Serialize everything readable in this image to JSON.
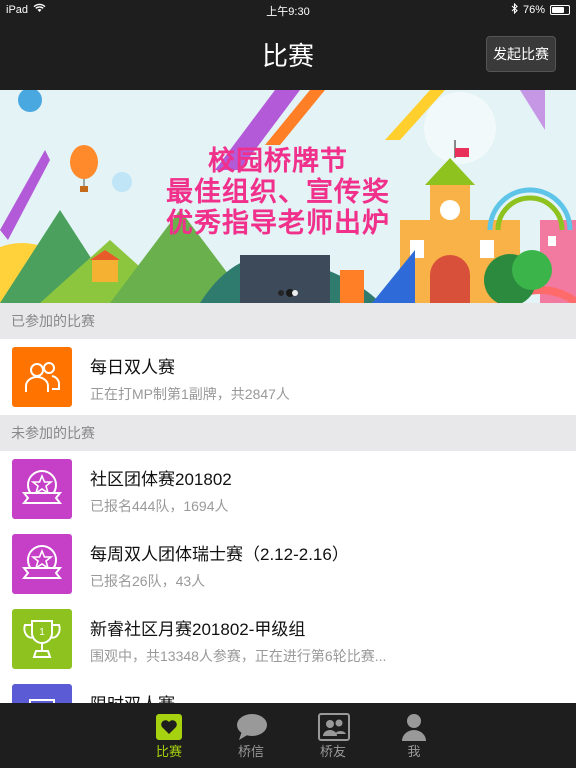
{
  "status": {
    "device": "iPad",
    "time": "上午9:30",
    "battery": "76%",
    "battery_level": 0.76
  },
  "nav": {
    "title": "比赛",
    "launch_button": "发起比赛"
  },
  "banner": {
    "lines": [
      "校园桥牌节",
      "最佳组织、宣传奖",
      "优秀指导老师出炉"
    ]
  },
  "sections": {
    "joined": "已参加的比赛",
    "not_joined": "未参加的比赛"
  },
  "joined_items": [
    {
      "name": "每日双人赛",
      "sub": "正在打MP制第1副牌，共2847人",
      "icon": "people-icon",
      "color": "#ff7300"
    }
  ],
  "other_items": [
    {
      "name": "社区团体赛201802",
      "sub": "已报名444队，1694人",
      "icon": "star-ribbon-icon",
      "color": "#c53fc7"
    },
    {
      "name": "每周双人团体瑞士赛（2.12-2.16）",
      "sub": "已报名26队，43人",
      "icon": "star-ribbon-icon",
      "color": "#c53fc7"
    },
    {
      "name": "新睿社区月赛201802-甲级组",
      "sub": "围观中，共13348人参赛，正在进行第6轮比赛...",
      "icon": "trophy-icon",
      "color": "#8dc21f"
    },
    {
      "name": "限时双人赛",
      "sub": "",
      "icon": "list-icon",
      "color": "#5b5bd6"
    }
  ],
  "tabs": [
    {
      "label": "比赛",
      "icon": "heart-card-icon",
      "active": true
    },
    {
      "label": "桥信",
      "icon": "chat-bubble-icon",
      "active": false
    },
    {
      "label": "桥友",
      "icon": "contacts-icon",
      "active": false
    },
    {
      "label": "我",
      "icon": "person-icon",
      "active": false
    }
  ]
}
